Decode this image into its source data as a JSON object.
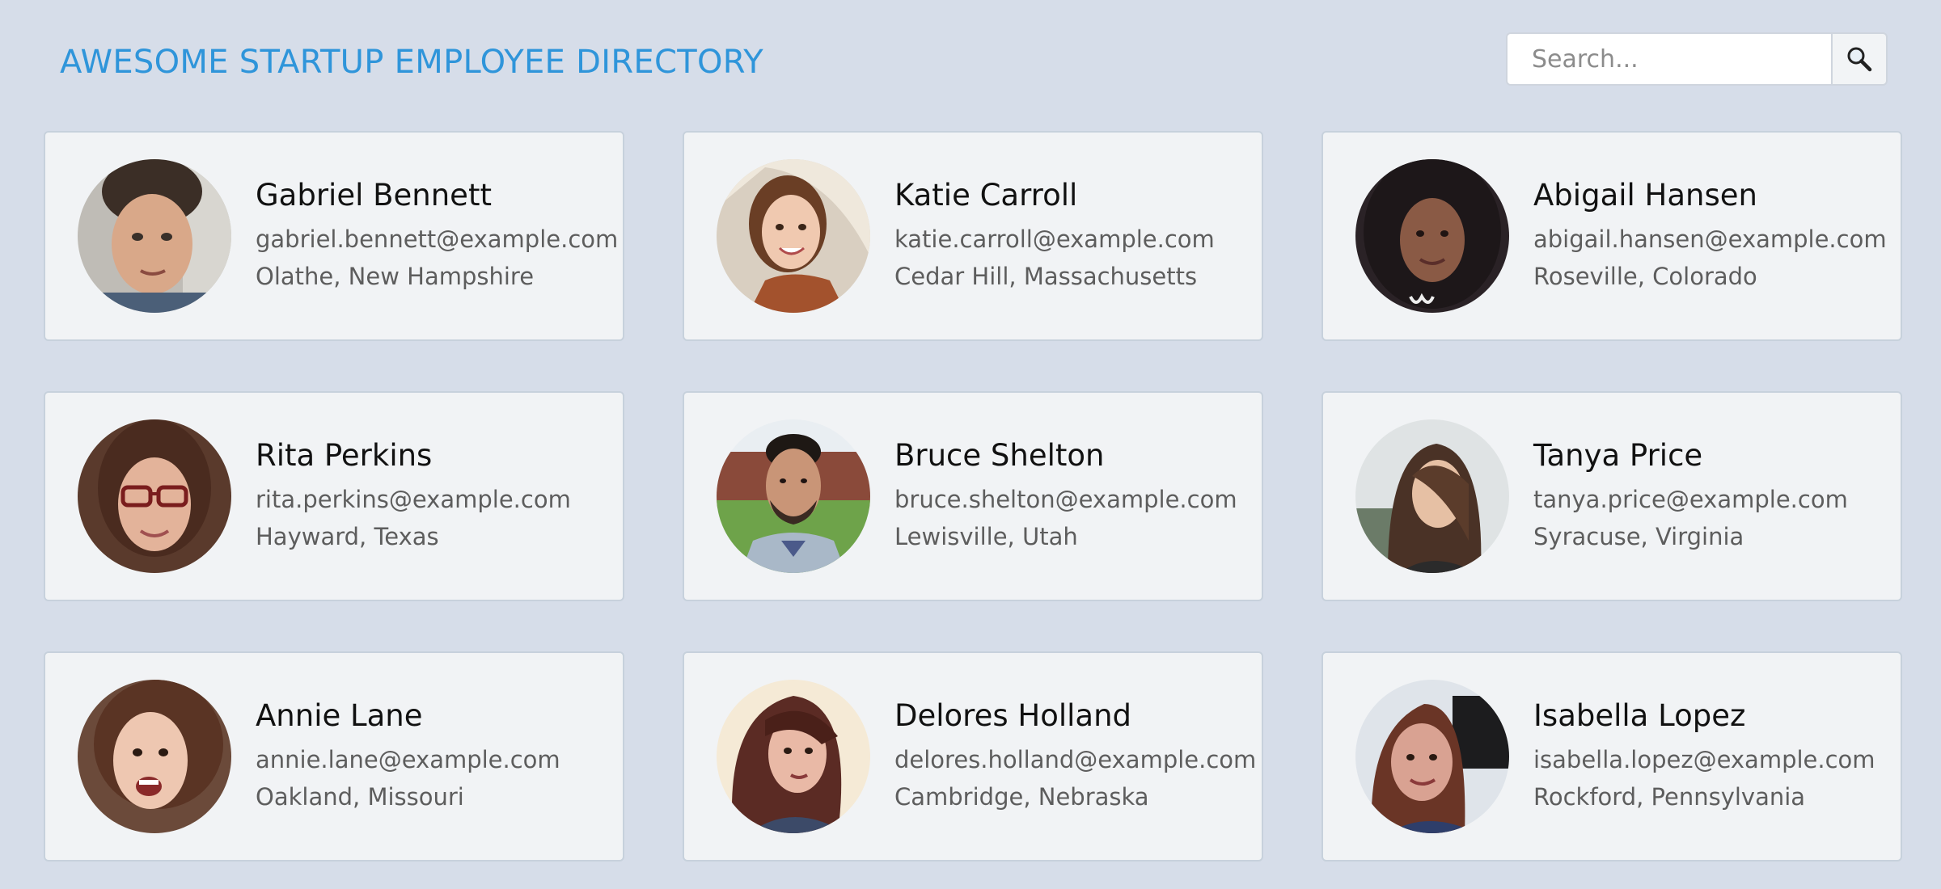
{
  "header": {
    "title": "AWESOME STARTUP EMPLOYEE DIRECTORY"
  },
  "search": {
    "placeholder": "Search...",
    "button_icon": "magnifier-icon"
  },
  "colors": {
    "accent": "#2f95da",
    "background": "#d6dde9",
    "card": "#f1f3f5"
  },
  "employees": [
    {
      "name": "Gabriel Bennett",
      "email": "gabriel.bennett@example.com",
      "location": "Olathe, New Hampshire"
    },
    {
      "name": "Katie Carroll",
      "email": "katie.carroll@example.com",
      "location": "Cedar Hill, Massachusetts"
    },
    {
      "name": "Abigail Hansen",
      "email": "abigail.hansen@example.com",
      "location": "Roseville, Colorado"
    },
    {
      "name": "Rita Perkins",
      "email": "rita.perkins@example.com",
      "location": "Hayward, Texas"
    },
    {
      "name": "Bruce Shelton",
      "email": "bruce.shelton@example.com",
      "location": "Lewisville, Utah"
    },
    {
      "name": "Tanya Price",
      "email": "tanya.price@example.com",
      "location": "Syracuse, Virginia"
    },
    {
      "name": "Annie Lane",
      "email": "annie.lane@example.com",
      "location": "Oakland, Missouri"
    },
    {
      "name": "Delores Holland",
      "email": "delores.holland@example.com",
      "location": "Cambridge, Nebraska"
    },
    {
      "name": "Isabella Lopez",
      "email": "isabella.lopez@example.com",
      "location": "Rockford, Pennsylvania"
    }
  ]
}
